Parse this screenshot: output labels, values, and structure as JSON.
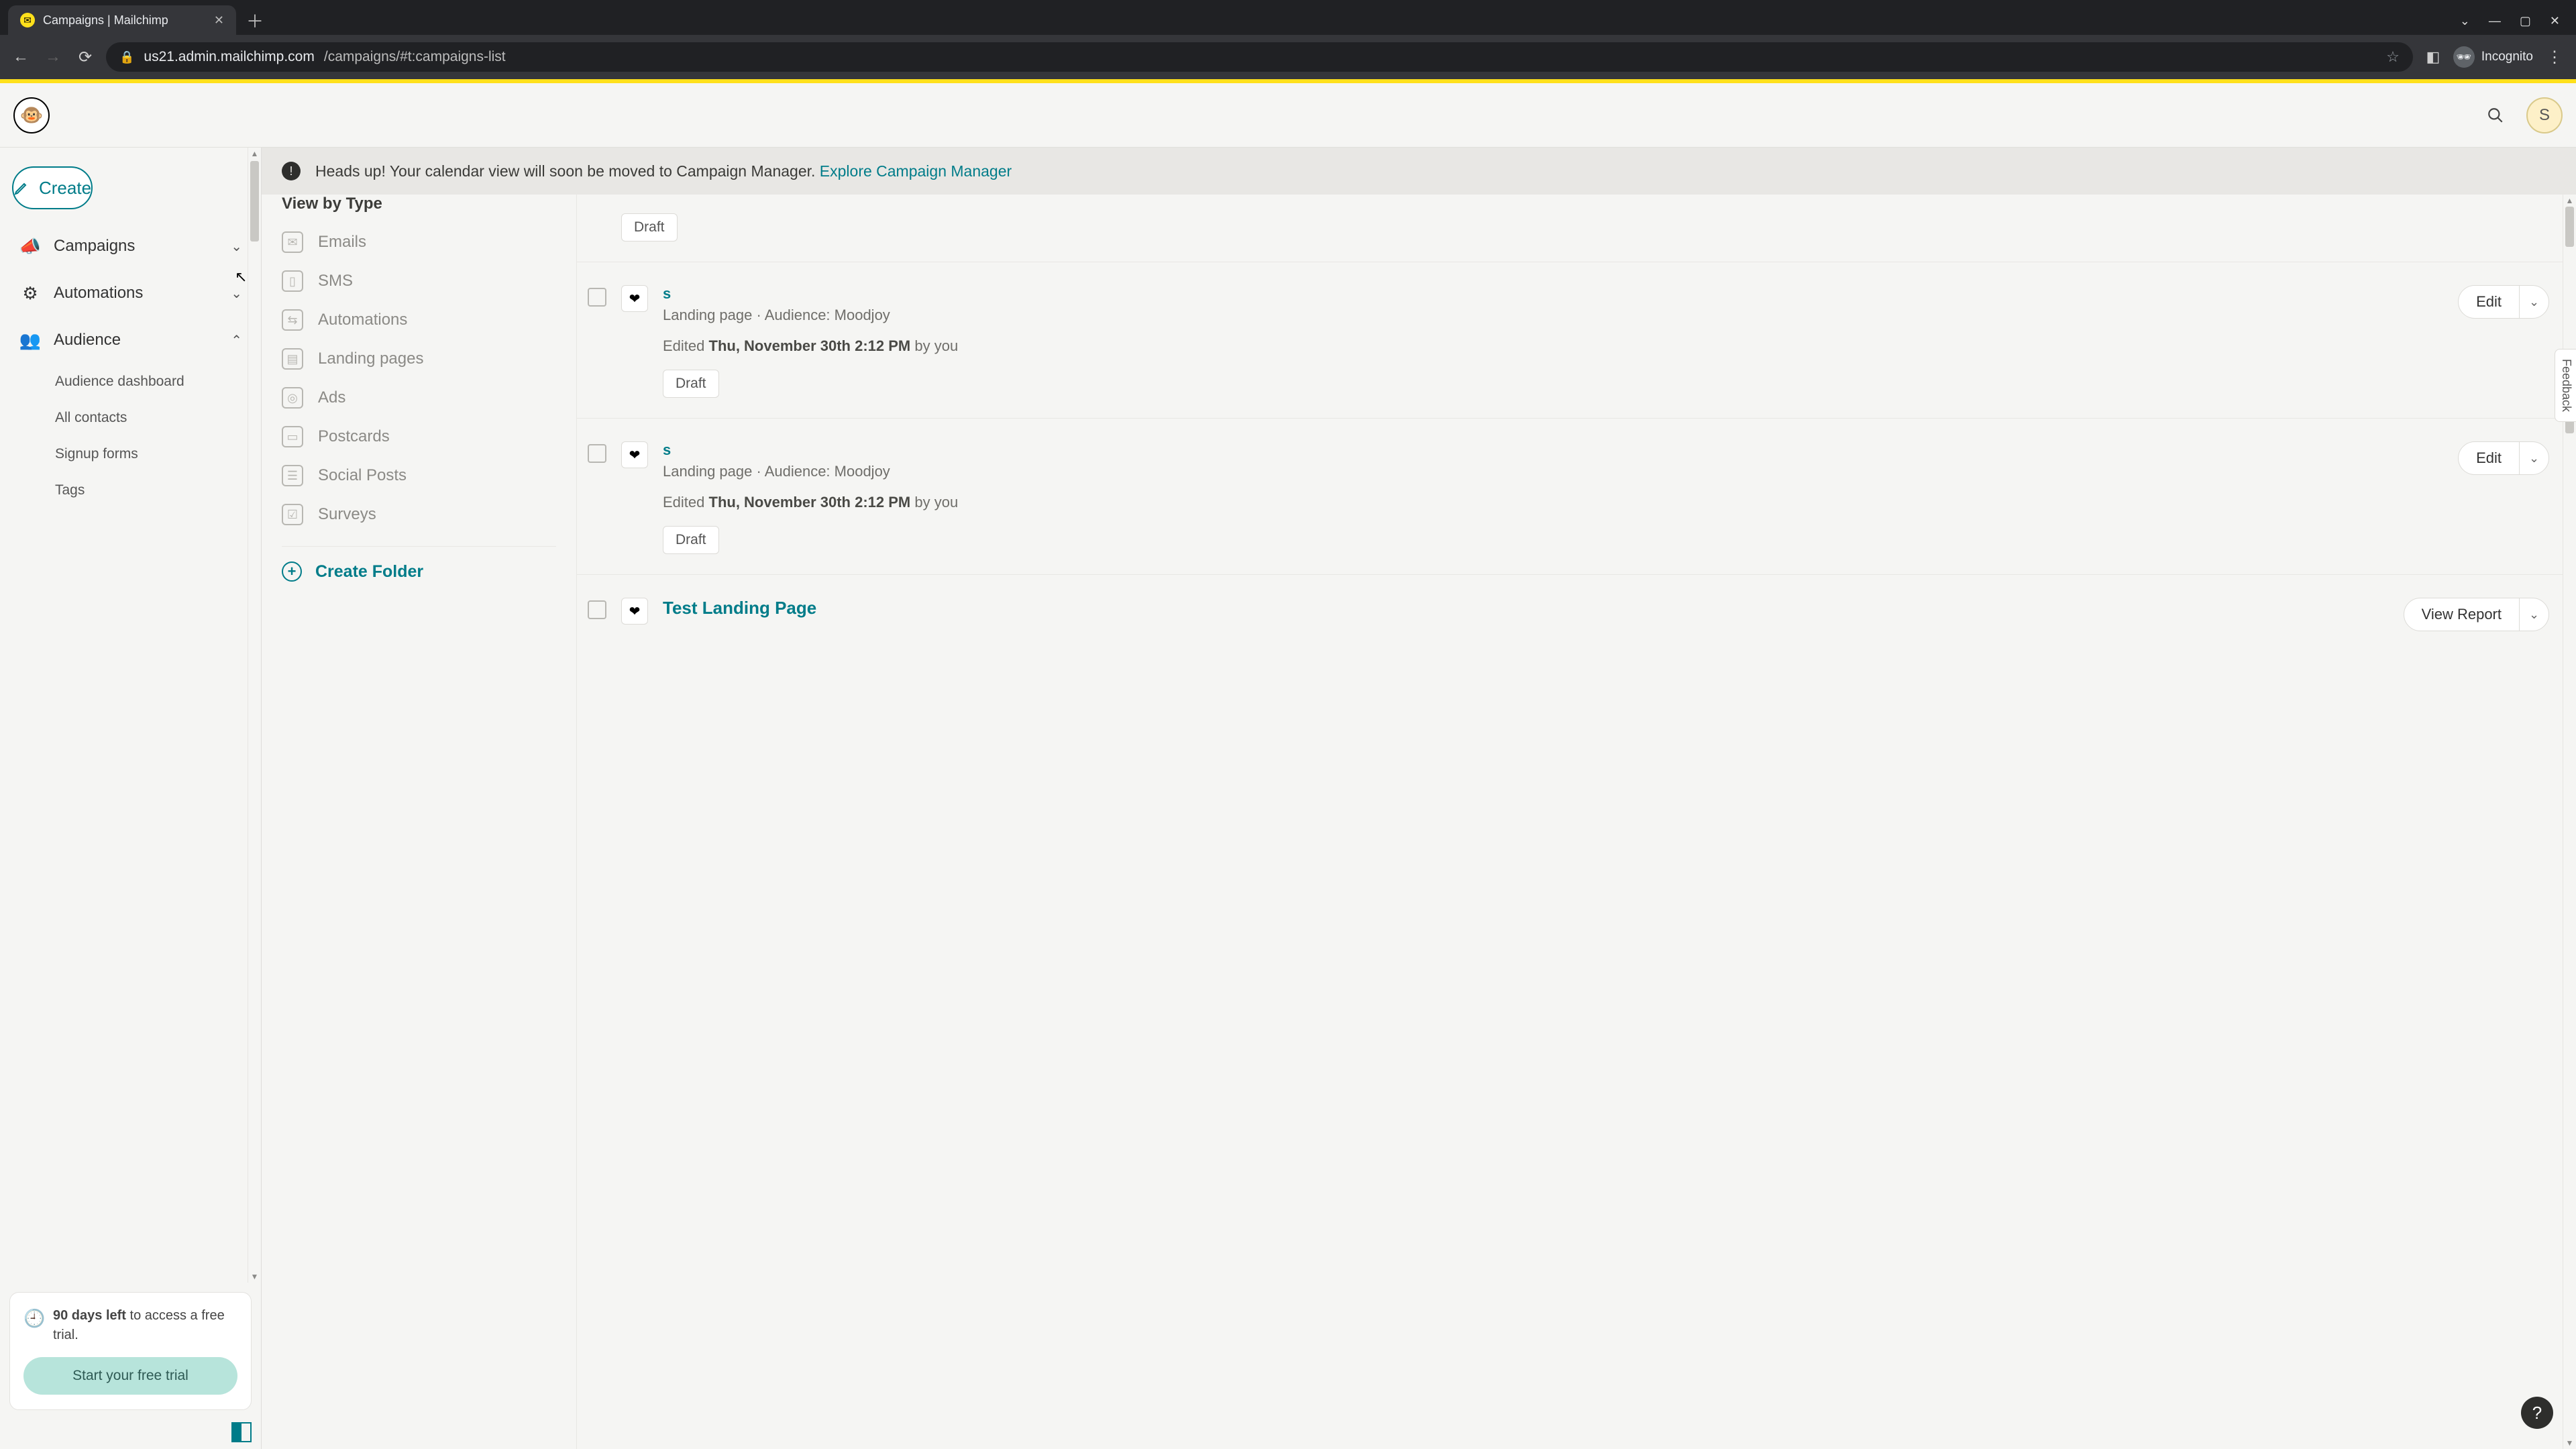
{
  "browser": {
    "tab_title": "Campaigns | Mailchimp",
    "url_host": "us21.admin.mailchimp.com",
    "url_path": "/campaigns/#t:campaigns-list",
    "incognito_label": "Incognito"
  },
  "header": {
    "avatar_initial": "S"
  },
  "sidebar": {
    "create_label": "Create",
    "nav": {
      "campaigns": "Campaigns",
      "automations": "Automations",
      "audience": "Audience"
    },
    "audience_sub": {
      "dashboard": "Audience dashboard",
      "all_contacts": "All contacts",
      "signup_forms": "Signup forms",
      "tags": "Tags"
    },
    "trial": {
      "days_bold": "90 days left",
      "days_rest": " to access a free trial.",
      "cta": "Start your free trial"
    }
  },
  "banner": {
    "text": "Heads up! Your calendar view will soon be moved to Campaign Manager. ",
    "link": "Explore Campaign Manager"
  },
  "filters": {
    "heading": "View by Type",
    "types": {
      "emails": "Emails",
      "sms": "SMS",
      "automations": "Automations",
      "landing": "Landing pages",
      "ads": "Ads",
      "postcards": "Postcards",
      "social": "Social Posts",
      "surveys": "Surveys"
    },
    "create_folder": "Create Folder"
  },
  "list": {
    "status_draft": "Draft",
    "edit_label": "Edit",
    "view_report_label": "View Report",
    "items": [
      {
        "title": "s",
        "subtitle": "Landing page · Audience: Moodjoy",
        "edited_prefix": "Edited ",
        "edited_date": "Thu, November 30th 2:12 PM",
        "edited_by": " by you",
        "status": "Draft"
      },
      {
        "title": "s",
        "subtitle": "Landing page · Audience: Moodjoy",
        "edited_prefix": "Edited ",
        "edited_date": "Thu, November 30th 2:12 PM",
        "edited_by": " by you",
        "status": "Draft"
      },
      {
        "title": "Test Landing Page"
      }
    ]
  },
  "misc": {
    "feedback": "Feedback",
    "help": "?"
  }
}
